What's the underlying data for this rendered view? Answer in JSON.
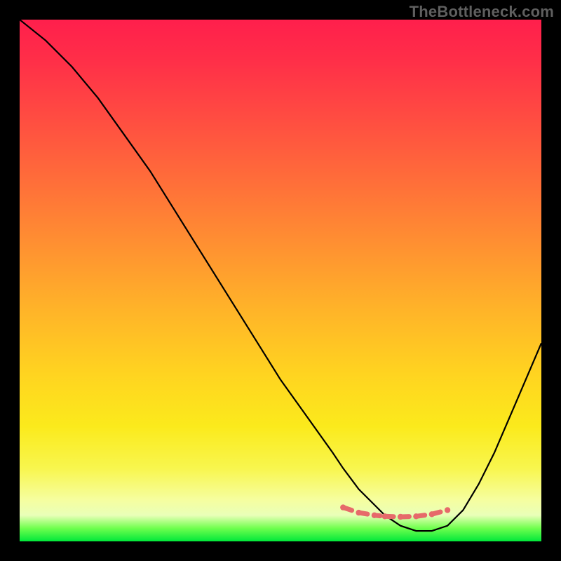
{
  "watermark": "TheBottleneck.com",
  "chart_data": {
    "type": "line",
    "title": "",
    "xlabel": "",
    "ylabel": "",
    "xlim": [
      0,
      100
    ],
    "ylim": [
      0,
      100
    ],
    "grid": false,
    "series": [
      {
        "name": "bottleneck-curve",
        "x": [
          0,
          5,
          10,
          15,
          20,
          25,
          30,
          35,
          40,
          45,
          50,
          55,
          60,
          62,
          65,
          68,
          70,
          73,
          76,
          79,
          82,
          85,
          88,
          91,
          94,
          97,
          100
        ],
        "values": [
          100,
          96,
          91,
          85,
          78,
          71,
          63,
          55,
          47,
          39,
          31,
          24,
          17,
          14,
          10,
          7,
          5,
          3,
          2,
          2,
          3,
          6,
          11,
          17,
          24,
          31,
          38
        ]
      }
    ],
    "highlight": {
      "name": "optimal-range",
      "x": [
        62,
        65,
        68,
        70,
        73,
        76,
        79,
        82
      ],
      "values": [
        6.5,
        5.5,
        5.0,
        4.8,
        4.7,
        4.8,
        5.2,
        6.0
      ],
      "color": "#e66a6a"
    },
    "background_gradient": [
      "#ff1f4c",
      "#ff6b3a",
      "#ffd420",
      "#f6fe9f",
      "#00e83a"
    ]
  }
}
